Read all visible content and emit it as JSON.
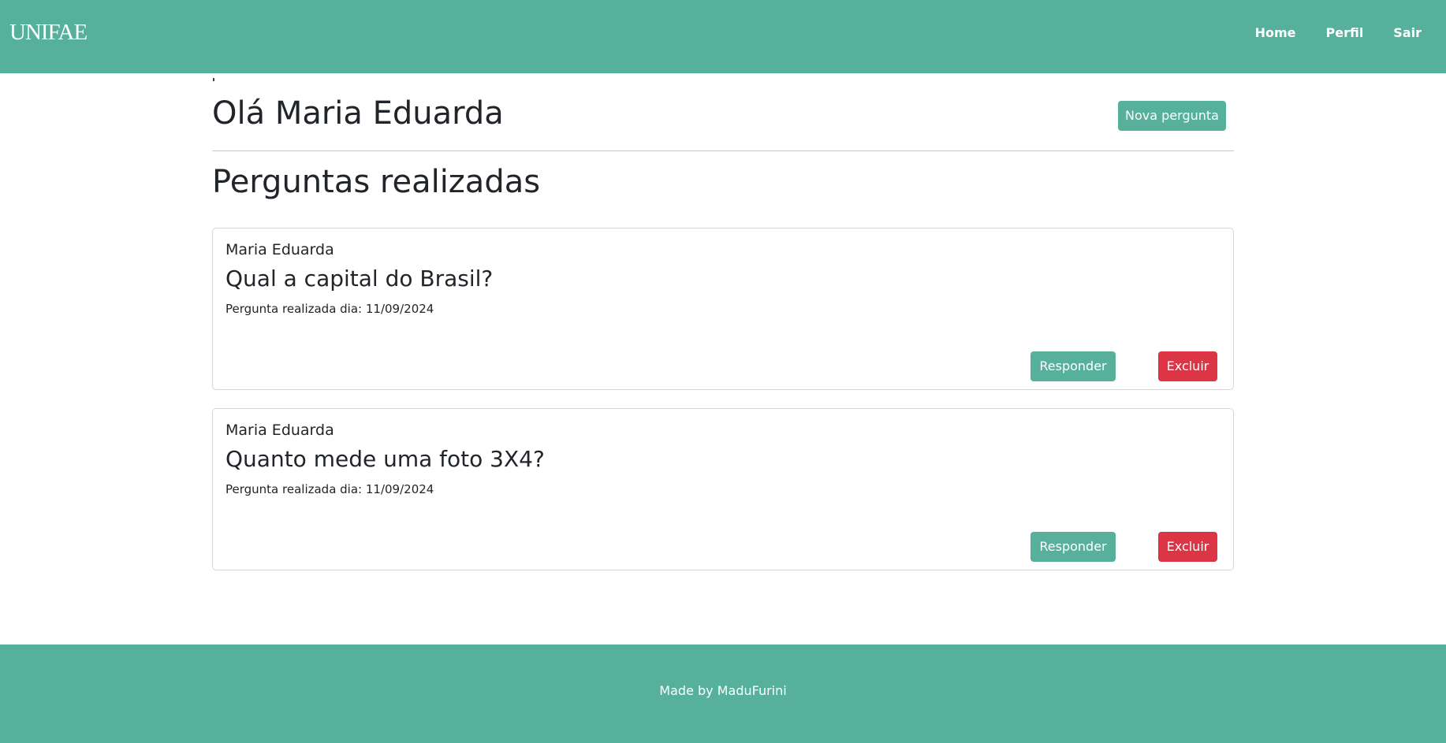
{
  "navbar": {
    "logo": "UNIFAE",
    "links": [
      {
        "label": "Home"
      },
      {
        "label": "Perfil"
      },
      {
        "label": "Sair"
      }
    ]
  },
  "header": {
    "greeting": "Olá Maria Eduarda",
    "new_question_label": "Nova pergunta"
  },
  "section_title": "Perguntas realizadas",
  "questions": [
    {
      "author": "Maria Eduarda",
      "question": "Qual a capital do Brasil?",
      "date_label": "Pergunta realizada dia:",
      "date": "11/09/2024",
      "answer_label": "Responder",
      "delete_label": "Excluir"
    },
    {
      "author": "Maria Eduarda",
      "question": "Quanto mede uma foto 3X4?",
      "date_label": "Pergunta realizada dia:",
      "date": "11/09/2024",
      "answer_label": "Responder",
      "delete_label": "Excluir"
    }
  ],
  "footer": {
    "text": "Made by MaduFurini"
  },
  "colors": {
    "brand": "#57b09c",
    "danger": "#dc3545"
  }
}
